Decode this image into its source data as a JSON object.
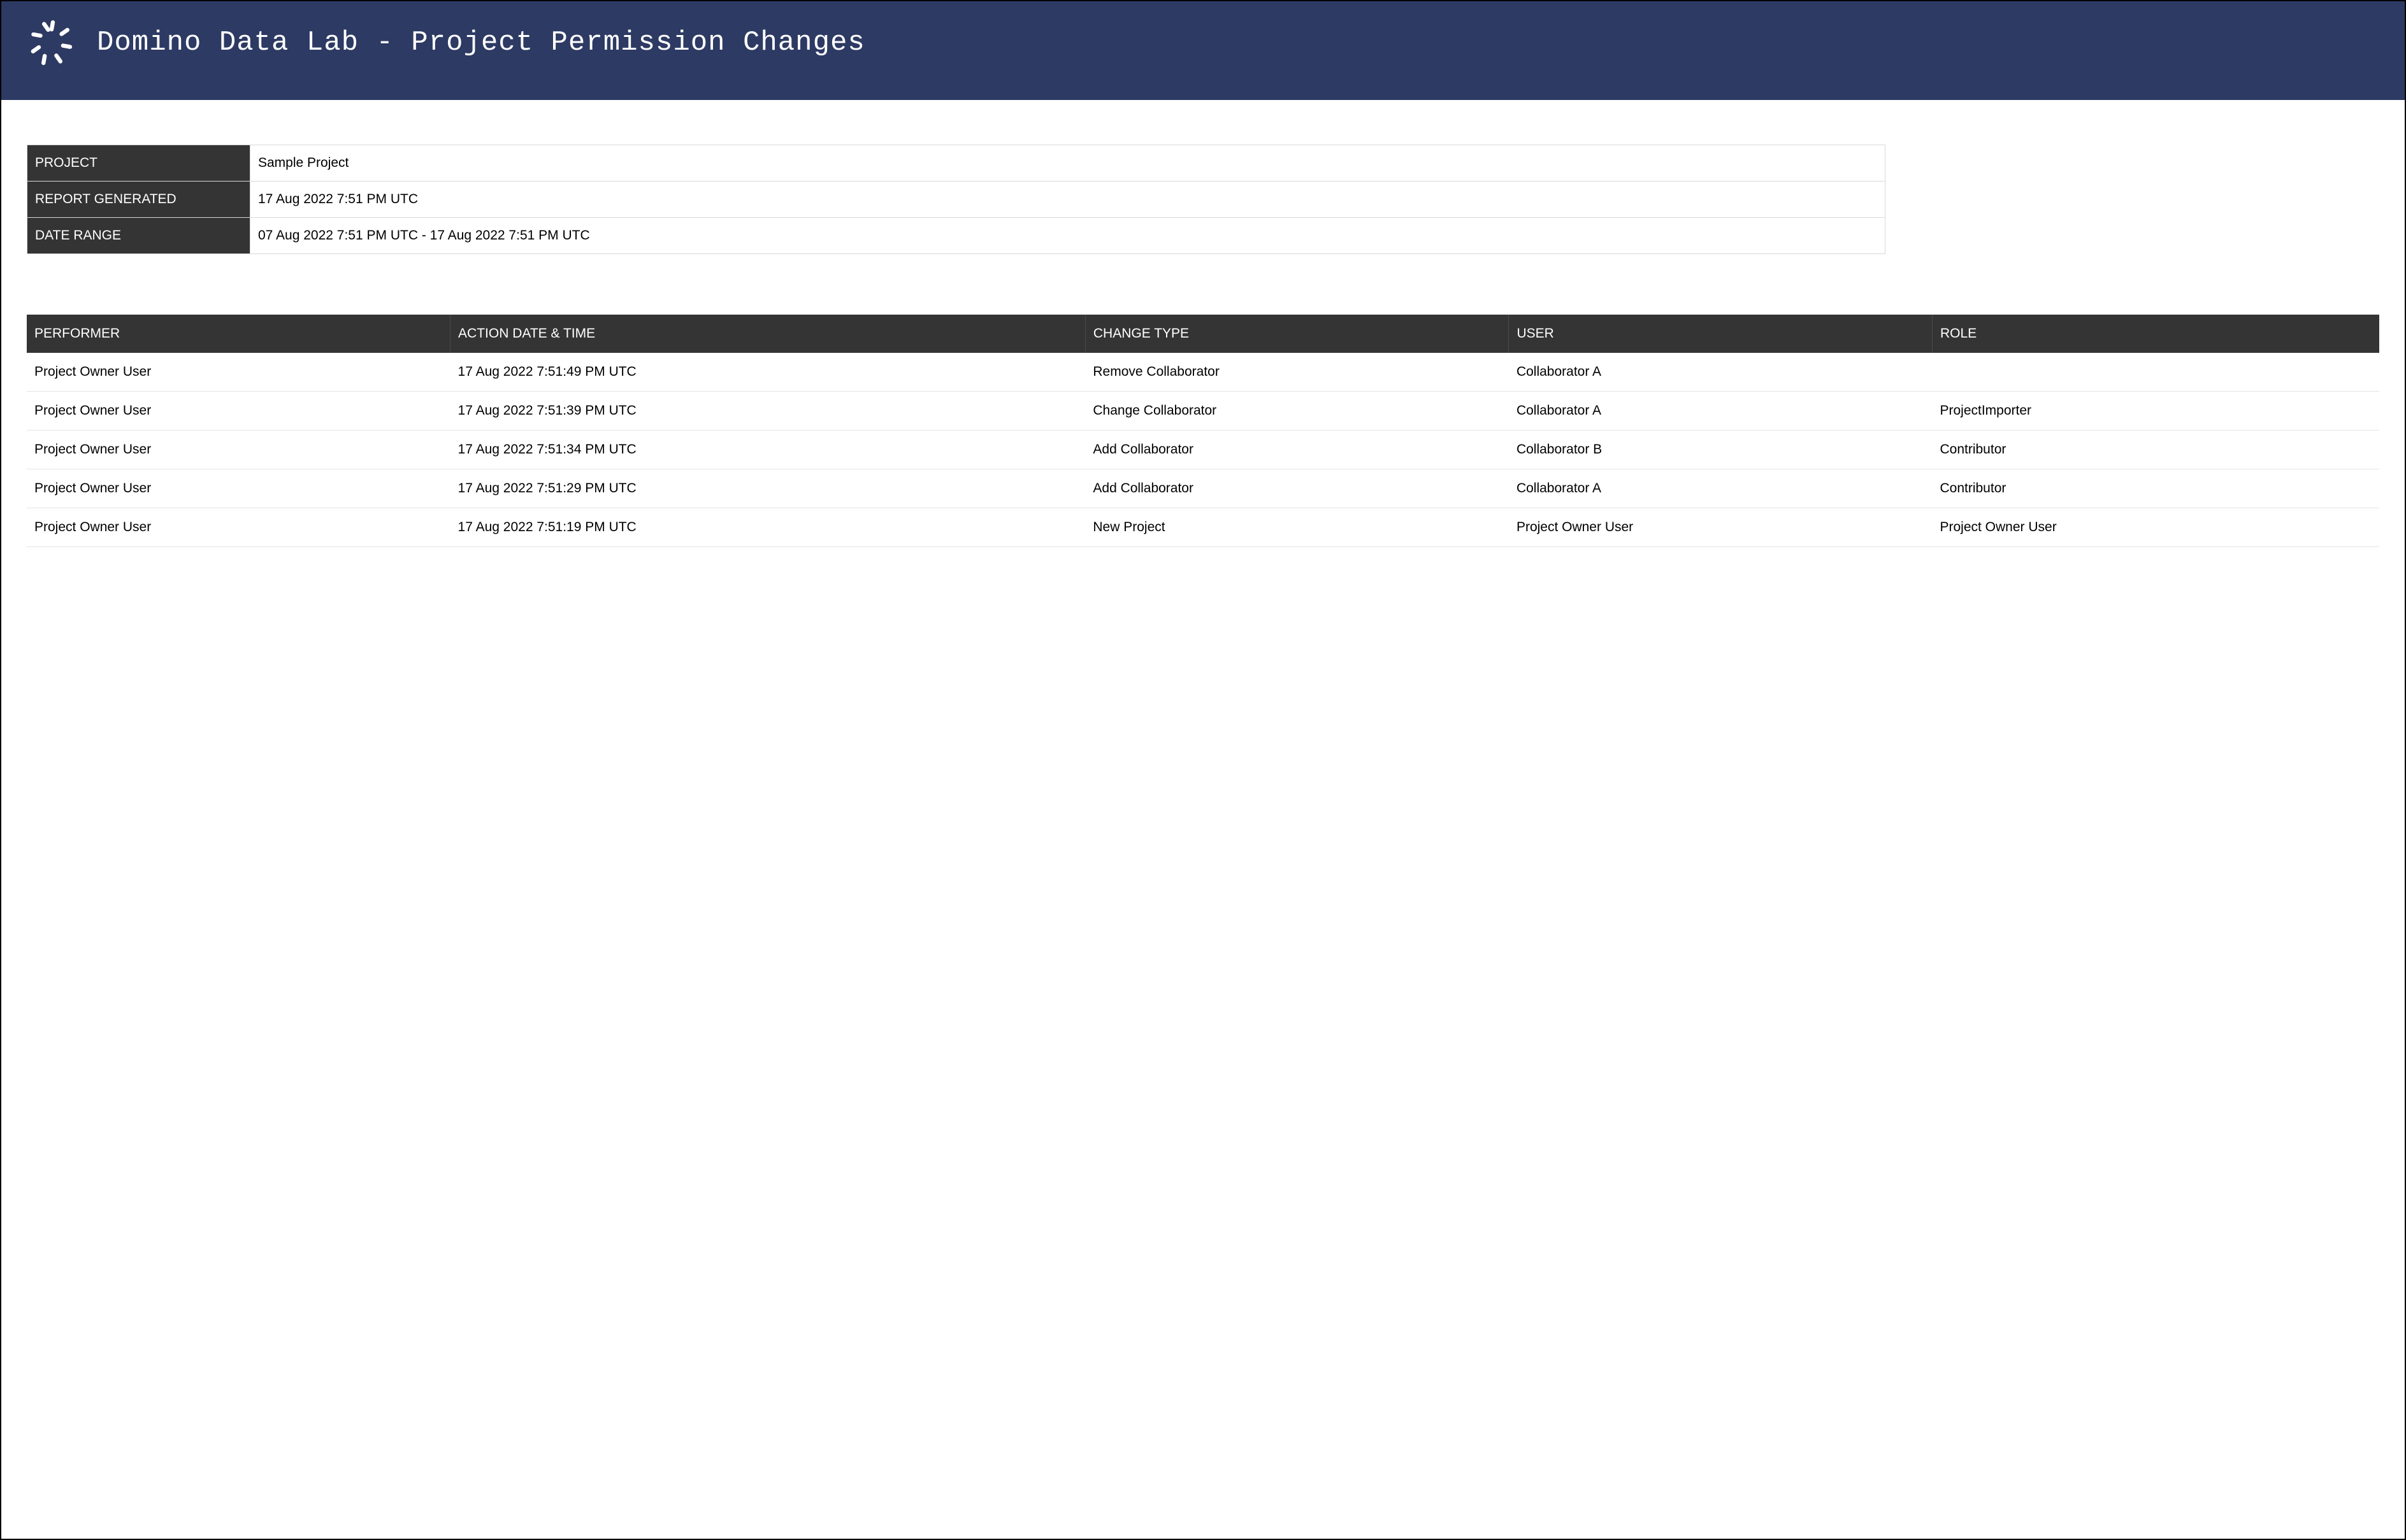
{
  "header": {
    "title": "Domino Data Lab - Project Permission Changes"
  },
  "meta": {
    "labels": {
      "project": "PROJECT",
      "report_generated": "REPORT GENERATED",
      "date_range": "DATE RANGE"
    },
    "values": {
      "project": "Sample Project",
      "report_generated": "17 Aug 2022 7:51 PM UTC",
      "date_range": "07 Aug 2022 7:51 PM UTC - 17 Aug 2022 7:51 PM UTC"
    }
  },
  "table": {
    "headers": {
      "performer": "PERFORMER",
      "action_datetime": "ACTION DATE & TIME",
      "change_type": "CHANGE TYPE",
      "user": "USER",
      "role": "ROLE"
    },
    "rows": [
      {
        "performer": "Project Owner User",
        "action_datetime": "17 Aug 2022 7:51:49 PM UTC",
        "change_type": "Remove Collaborator",
        "user": "Collaborator A",
        "role": ""
      },
      {
        "performer": "Project Owner User",
        "action_datetime": "17 Aug 2022 7:51:39 PM UTC",
        "change_type": "Change Collaborator",
        "user": "Collaborator A",
        "role": "ProjectImporter"
      },
      {
        "performer": "Project Owner User",
        "action_datetime": "17 Aug 2022 7:51:34 PM UTC",
        "change_type": "Add Collaborator",
        "user": "Collaborator B",
        "role": "Contributor"
      },
      {
        "performer": "Project Owner User",
        "action_datetime": "17 Aug 2022 7:51:29 PM UTC",
        "change_type": "Add Collaborator",
        "user": "Collaborator A",
        "role": "Contributor"
      },
      {
        "performer": "Project Owner User",
        "action_datetime": "17 Aug 2022 7:51:19 PM UTC",
        "change_type": "New Project",
        "user": "Project Owner User",
        "role": "Project Owner User"
      }
    ]
  }
}
